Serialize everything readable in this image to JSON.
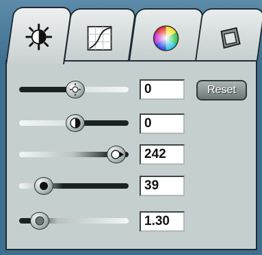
{
  "tabs": [
    {
      "name": "brightness",
      "icon": "brightness-icon",
      "active": true
    },
    {
      "name": "curves",
      "icon": "curves-graph-icon",
      "active": false
    },
    {
      "name": "color",
      "icon": "color-wheel-icon",
      "active": false
    },
    {
      "name": "transform",
      "icon": "rotate-shape-icon",
      "active": false
    }
  ],
  "sliders": [
    {
      "value": "0",
      "fraction": 0.5
    },
    {
      "value": "0",
      "fraction": 0.5
    },
    {
      "value": "242",
      "fraction": 0.95
    },
    {
      "value": "39",
      "fraction": 0.15
    },
    {
      "value": "1.30",
      "fraction": 0.2
    }
  ],
  "reset_label": "Reset",
  "colors": {
    "frame": "#3f6f8e",
    "panel": "#c6cfcf",
    "track_dark": "#1a2222",
    "track_light": "#f4f6f6"
  }
}
